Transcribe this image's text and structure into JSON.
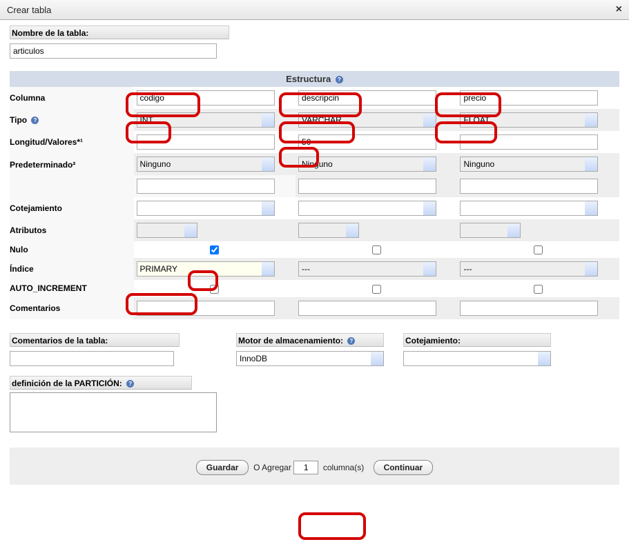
{
  "dialog": {
    "title": "Crear tabla",
    "close_icon": "×"
  },
  "table_name": {
    "label": "Nombre de la tabla:",
    "value": "articulos"
  },
  "structure": {
    "header": "Estructura",
    "rows": {
      "columna": "Columna",
      "tipo": "Tipo",
      "longitud": "Longitud/Valores*¹",
      "predeterminado": "Predeterminado²",
      "cotejamiento": "Cotejamiento",
      "atributos": "Atributos",
      "nulo": "Nulo",
      "indice": "Índice",
      "auto_increment": "AUTO_INCREMENT",
      "comentarios": "Comentarios"
    },
    "columns": [
      {
        "name": "codigo",
        "type": "INT",
        "length": "",
        "default": "Ninguno",
        "collation": "",
        "attributes": "",
        "null": true,
        "index": "PRIMARY",
        "auto_increment": false,
        "comment": ""
      },
      {
        "name": "descripcin",
        "type": "VARCHAR",
        "length": "50",
        "default": "Ninguno",
        "collation": "",
        "attributes": "",
        "null": false,
        "index": "---",
        "auto_increment": false,
        "comment": ""
      },
      {
        "name": "precio",
        "type": "FLOAT",
        "length": "",
        "default": "Ninguno",
        "collation": "",
        "attributes": "",
        "null": false,
        "index": "---",
        "auto_increment": false,
        "comment": ""
      }
    ]
  },
  "footer": {
    "table_comments_label": "Comentarios de la tabla:",
    "table_comments_value": "",
    "storage_engine_label": "Motor de almacenamiento:",
    "storage_engine_value": "InnoDB",
    "collation_label": "Cotejamiento:",
    "collation_value": "",
    "partition_label": "definición de la PARTICIÓN:",
    "partition_value": ""
  },
  "actions": {
    "save": "Guardar",
    "or": "O",
    "add": "Agregar",
    "add_count": "1",
    "columns_word": "columna(s)",
    "continue": "Continuar"
  }
}
